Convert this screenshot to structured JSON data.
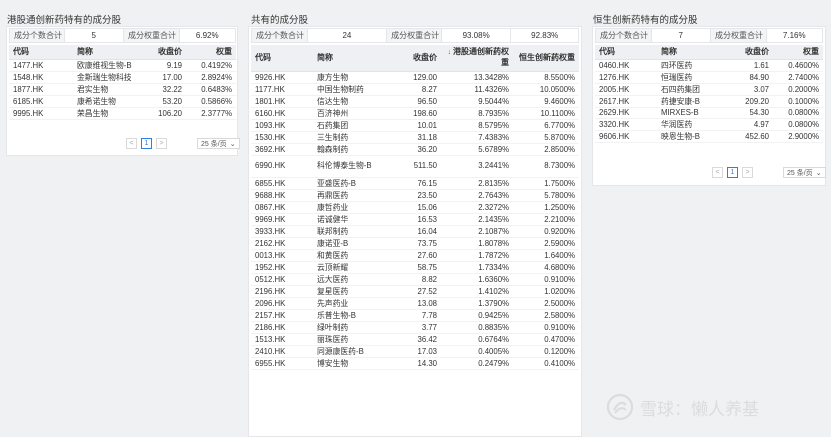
{
  "left": {
    "title": "港股通创新药特有的成分股",
    "summary": {
      "count_label": "成分个数合计",
      "count_value": "5",
      "weight_label": "成分权重合计",
      "weight_value": "6.92%"
    },
    "columns": [
      "代码",
      "简称",
      "收盘价",
      "权重"
    ],
    "rows": [
      [
        "1477.HK",
        "欧康维视生物-B",
        "9.19",
        "0.4192%"
      ],
      [
        "1548.HK",
        "金斯瑞生物科技",
        "17.00",
        "2.8924%"
      ],
      [
        "1877.HK",
        "君实生物",
        "32.22",
        "0.6483%"
      ],
      [
        "6185.HK",
        "康希诺生物",
        "53.20",
        "0.5866%"
      ],
      [
        "9995.HK",
        "荣昌生物",
        "106.20",
        "2.3777%"
      ]
    ],
    "pager": {
      "prev": "<",
      "page": "1",
      "next": ">",
      "size": "25 条/页"
    }
  },
  "middle": {
    "title": "共有的成分股",
    "summary": {
      "count_label": "成分个数合计",
      "count_value": "24",
      "weight_label": "成分权重合计",
      "weight_value_a": "93.08%",
      "weight_value_b": "92.83%"
    },
    "columns": [
      "代码",
      "简称",
      "收盘价",
      "港股通创新药权重",
      "恒生创新药权重"
    ],
    "sort_icon": "↓",
    "rows": [
      [
        "9926.HK",
        "康方生物",
        "129.00",
        "13.3428%",
        "8.5500%"
      ],
      [
        "1177.HK",
        "中国生物制药",
        "8.27",
        "11.4326%",
        "10.0500%"
      ],
      [
        "1801.HK",
        "信达生物",
        "96.50",
        "9.5044%",
        "9.4600%"
      ],
      [
        "6160.HK",
        "百济神州",
        "198.60",
        "8.7935%",
        "10.1100%"
      ],
      [
        "1093.HK",
        "石药集团",
        "10.01",
        "8.5795%",
        "6.7700%"
      ],
      [
        "1530.HK",
        "三生制药",
        "31.18",
        "7.4383%",
        "5.8700%"
      ],
      [
        "3692.HK",
        "翰森制药",
        "36.20",
        "5.6789%",
        "2.8500%"
      ],
      [
        "6990.HK",
        "科伦博泰生物-B",
        "511.50",
        "3.2441%",
        "8.7300%"
      ],
      [
        "6855.HK",
        "亚盛医药-B",
        "76.15",
        "2.8135%",
        "1.7500%"
      ],
      [
        "9688.HK",
        "再鼎医药",
        "23.50",
        "2.7643%",
        "5.7800%"
      ],
      [
        "0867.HK",
        "康哲药业",
        "15.06",
        "2.3272%",
        "1.2500%"
      ],
      [
        "9969.HK",
        "诺诚健华",
        "16.53",
        "2.1435%",
        "2.2100%"
      ],
      [
        "3933.HK",
        "联邦制药",
        "16.04",
        "2.1087%",
        "0.9200%"
      ],
      [
        "2162.HK",
        "康诺亚-B",
        "73.75",
        "1.8078%",
        "2.5900%"
      ],
      [
        "0013.HK",
        "和黄医药",
        "27.60",
        "1.7872%",
        "1.6400%"
      ],
      [
        "1952.HK",
        "云顶新耀",
        "58.75",
        "1.7334%",
        "4.6800%"
      ],
      [
        "0512.HK",
        "远大医药",
        "8.82",
        "1.6360%",
        "0.9100%"
      ],
      [
        "2196.HK",
        "复星医药",
        "27.52",
        "1.4102%",
        "1.0200%"
      ],
      [
        "2096.HK",
        "先声药业",
        "13.08",
        "1.3790%",
        "2.5000%"
      ],
      [
        "2157.HK",
        "乐普生物-B",
        "7.78",
        "0.9425%",
        "2.5800%"
      ],
      [
        "2186.HK",
        "绿叶制药",
        "3.77",
        "0.8835%",
        "0.9100%"
      ],
      [
        "1513.HK",
        "丽珠医药",
        "36.42",
        "0.6764%",
        "0.4700%"
      ],
      [
        "2410.HK",
        "同源康医药-B",
        "17.03",
        "0.4005%",
        "0.1200%"
      ],
      [
        "6955.HK",
        "博安生物",
        "14.30",
        "0.2479%",
        "0.4100%"
      ]
    ]
  },
  "right": {
    "title": "恒生创新药特有的成分股",
    "summary": {
      "count_label": "成分个数合计",
      "count_value": "7",
      "weight_label": "成分权重合计",
      "weight_value": "7.16%"
    },
    "columns": [
      "代码",
      "简称",
      "收盘价",
      "权重"
    ],
    "rows": [
      [
        "0460.HK",
        "四环医药",
        "1.61",
        "0.4600%"
      ],
      [
        "1276.HK",
        "恒瑞医药",
        "84.90",
        "2.7400%"
      ],
      [
        "2005.HK",
        "石四药集团",
        "3.07",
        "0.2000%"
      ],
      [
        "2617.HK",
        "药捷安康-B",
        "209.20",
        "0.1000%"
      ],
      [
        "2629.HK",
        "MIRXES-B",
        "54.30",
        "0.0800%"
      ],
      [
        "3320.HK",
        "华润医药",
        "4.97",
        "0.0800%"
      ],
      [
        "9606.HK",
        "映恩生物-B",
        "452.60",
        "2.9000%"
      ]
    ],
    "pager": {
      "prev": "<",
      "page": "1",
      "next": ">",
      "size": "25 条/页"
    }
  },
  "watermark": {
    "text": "雪球：懒人养基"
  }
}
